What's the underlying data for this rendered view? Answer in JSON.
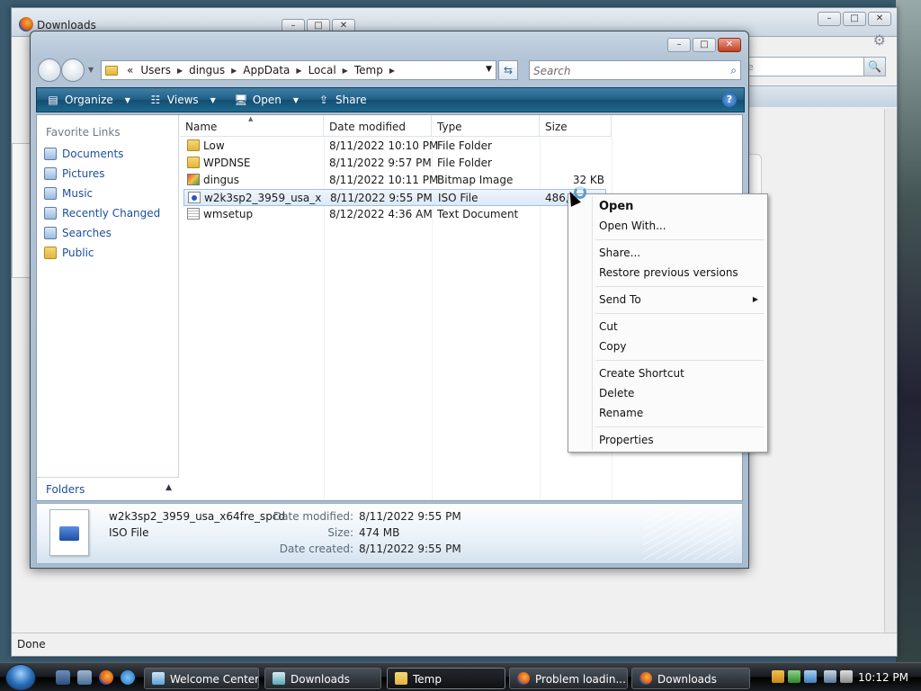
{
  "background_window": {
    "title": "Downloads",
    "status": "Done",
    "search_hint": "le"
  },
  "explorer": {
    "breadcrumb": [
      "Users",
      "dingus",
      "AppData",
      "Local",
      "Temp"
    ],
    "breadcrumb_prefix": "«",
    "search_placeholder": "Search",
    "toolbar": {
      "organize": "Organize",
      "views": "Views",
      "open": "Open",
      "share": "Share"
    },
    "nav": {
      "header": "Favorite Links",
      "items": [
        "Documents",
        "Pictures",
        "Music",
        "Recently Changed",
        "Searches",
        "Public"
      ],
      "folders_label": "Folders"
    },
    "columns": {
      "name": "Name",
      "date": "Date modified",
      "type": "Type",
      "size": "Size"
    },
    "files": [
      {
        "name": "Low",
        "date": "8/11/2022 10:10 PM",
        "type": "File Folder",
        "size": "",
        "icon": "folder-icon"
      },
      {
        "name": "WPDNSE",
        "date": "8/11/2022 9:57 PM",
        "type": "File Folder",
        "size": "",
        "icon": "folder-icon"
      },
      {
        "name": "dingus",
        "date": "8/11/2022 10:11 PM",
        "type": "Bitmap Image",
        "size": "32 KB",
        "icon": "bitmap-icon"
      },
      {
        "name": "w2k3sp2_3959_usa_x64...",
        "date": "8/11/2022 9:55 PM",
        "type": "ISO File",
        "size": "486,0?? KB",
        "icon": "iso-icon"
      },
      {
        "name": "wmsetup",
        "date": "8/12/2022 4:36 AM",
        "type": "Text Document",
        "size": "",
        "icon": "text-document-icon"
      }
    ],
    "details": {
      "name": "w2k3sp2_3959_usa_x64fre_spcd",
      "type": "ISO File",
      "date_modified_label": "Date modified:",
      "date_modified": "8/11/2022 9:55 PM",
      "size_label": "Size:",
      "size": "474 MB",
      "date_created_label": "Date created:",
      "date_created": "8/11/2022 9:55 PM"
    }
  },
  "context_menu": {
    "items": [
      "Open",
      "Open With...",
      "Share...",
      "Restore previous versions",
      "Send To",
      "Cut",
      "Copy",
      "Create Shortcut",
      "Delete",
      "Rename",
      "Properties"
    ]
  },
  "taskbar": {
    "buttons": [
      "Welcome Center",
      "Downloads",
      "Temp",
      "Problem loadin...",
      "Downloads"
    ],
    "active": "Temp",
    "clock": "10:12 PM"
  }
}
